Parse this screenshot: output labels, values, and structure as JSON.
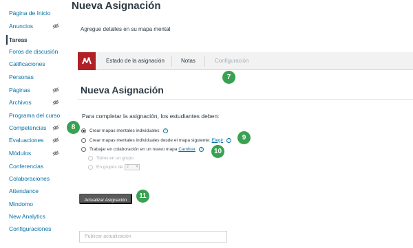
{
  "sidebar": {
    "items": [
      {
        "label": "Página de Inicio",
        "hidden": false
      },
      {
        "label": "Anuncios",
        "hidden": true
      },
      {
        "label": "Tareas",
        "hidden": false,
        "active": true
      },
      {
        "label": "Foros de discusión",
        "hidden": false
      },
      {
        "label": "Calificaciones",
        "hidden": false
      },
      {
        "label": "Personas",
        "hidden": false
      },
      {
        "label": "Páginas",
        "hidden": true
      },
      {
        "label": "Archivos",
        "hidden": true
      },
      {
        "label": "Programa del curso",
        "hidden": false
      },
      {
        "label": "Competencias",
        "hidden": true
      },
      {
        "label": "Evaluaciones",
        "hidden": true
      },
      {
        "label": "Módulos",
        "hidden": true
      },
      {
        "label": "Conferencias",
        "hidden": false
      },
      {
        "label": "Colaboraciones",
        "hidden": false
      },
      {
        "label": "Attendance",
        "hidden": false
      },
      {
        "label": "Mindomo",
        "hidden": false
      },
      {
        "label": "New Analytics",
        "hidden": false
      },
      {
        "label": "Configuraciones",
        "hidden": false
      }
    ]
  },
  "header": {
    "title": "Nueva Asignación",
    "subtitle": "Agregue detalles en su mapa mental"
  },
  "tabs": {
    "logo_icon": "mindomo-logo-icon",
    "items": [
      {
        "label": "Estado de la asignación"
      },
      {
        "label": "Notas"
      },
      {
        "label": "Configuración",
        "disabled": true
      }
    ]
  },
  "form": {
    "section_title": "Nueva Asignación",
    "instruction": "Para completar la asignación, los estudiantes deben:",
    "options": [
      {
        "label": "Crear mapas mentales individuales",
        "checked": true
      },
      {
        "label": "Crear mapas mentales individuales desde el mapa siguiente:",
        "link": "Elegir",
        "checked": false
      },
      {
        "label": "Trabajar en colaboración en un nuevo mapa",
        "link": "Cambiar",
        "checked": false
      }
    ],
    "sub_options": [
      {
        "label": "Todos en un grupo"
      },
      {
        "label": "En grupos de",
        "select_value": "2"
      }
    ],
    "help_symbol": "?",
    "update_button": "Actualizar Asignación",
    "publish_placeholder": "Publicar actualización"
  },
  "badges": [
    "7",
    "8",
    "9",
    "10",
    "11"
  ],
  "colors": {
    "link": "#0770a3",
    "brand_red": "#b02126",
    "badge_green": "#3aa153",
    "button_gray": "#5b5b5b"
  }
}
